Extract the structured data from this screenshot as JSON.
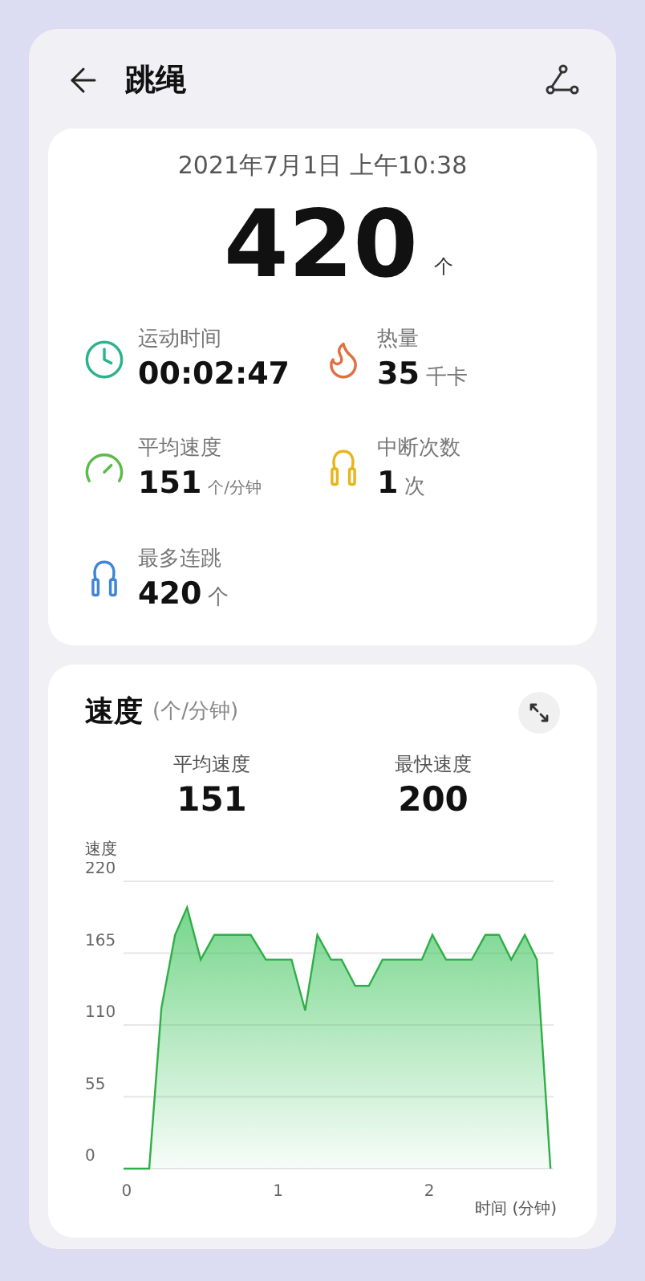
{
  "header": {
    "title": "跳绳"
  },
  "summary": {
    "datetime": "2021年7月1日 上午10:38",
    "count": "420",
    "count_unit": "个"
  },
  "stats": [
    {
      "label": "运动时间",
      "value": "00:02:47",
      "color": "#2bb38f"
    },
    {
      "label": "热量",
      "value": "35",
      "unit": "千卡",
      "color": "#e0703f"
    },
    {
      "label": "平均速度",
      "value": "151",
      "unit": "个/分钟",
      "color": "#5cbb4a"
    },
    {
      "label": "中断次数",
      "value": "1",
      "unit": "次",
      "color": "#e8b51c"
    },
    {
      "label": "最多连跳",
      "value": "420",
      "unit": "个",
      "color": "#3f86d8"
    }
  ],
  "speed_card": {
    "title": "速度",
    "unit": "(个/分钟)",
    "metrics": [
      {
        "label": "平均速度",
        "value": "151"
      },
      {
        "label": "最快速度",
        "value": "200"
      }
    ],
    "chart_data": {
      "type": "area",
      "ylabel": "速度",
      "xlabel": "时间 (分钟)",
      "xlim": [
        -0.02,
        2.82
      ],
      "ylim": [
        0,
        220
      ],
      "xticks": [
        0,
        1,
        2
      ],
      "yticks": [
        0,
        55,
        110,
        165,
        220
      ],
      "grid": true,
      "x": [
        -0.02,
        0.15,
        0.23,
        0.32,
        0.4,
        0.49,
        0.58,
        0.82,
        0.92,
        1.09,
        1.18,
        1.26,
        1.35,
        1.42,
        1.51,
        1.6,
        1.69,
        1.95,
        2.02,
        2.11,
        2.28,
        2.37,
        2.46,
        2.54,
        2.63,
        2.71,
        2.8
      ],
      "series": [
        {
          "color": "#3cc45a",
          "values": [
            0,
            0,
            123,
            179,
            200,
            160,
            179,
            179,
            160,
            160,
            121,
            179,
            160,
            160,
            140,
            140,
            160,
            160,
            179,
            160,
            160,
            179,
            179,
            160,
            179,
            160,
            0
          ]
        }
      ]
    }
  }
}
